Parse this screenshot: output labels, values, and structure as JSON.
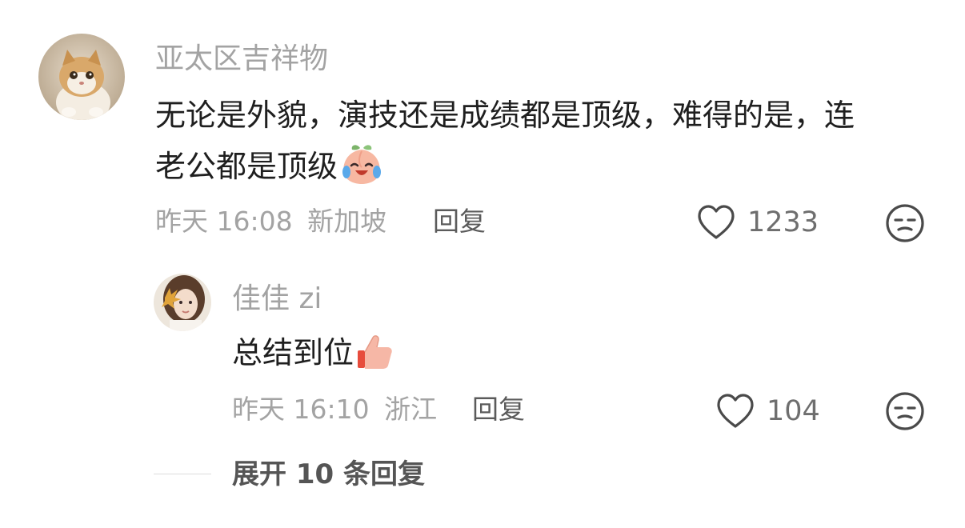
{
  "comment": {
    "username": "亚太区吉祥物",
    "text_line1": "无论是外貌，演技还是成绩都是顶级，难得的是，连",
    "text_line2": "老公都是顶级",
    "emoji": "crying-laughing-peach-emoji",
    "time": "昨天 16:08",
    "location": "新加坡",
    "reply_label": "回复",
    "likes": "1233"
  },
  "reply": {
    "username": "佳佳 zi",
    "text": "总结到位",
    "emoji": "thumbs-up-emoji",
    "time": "昨天 16:10",
    "location": "浙江",
    "reply_label": "回复",
    "likes": "104"
  },
  "expand": {
    "label": "展开 10 条回复"
  },
  "colors": {
    "secondary_text": "#a3a3a3",
    "primary_text": "#1f1f1f"
  }
}
